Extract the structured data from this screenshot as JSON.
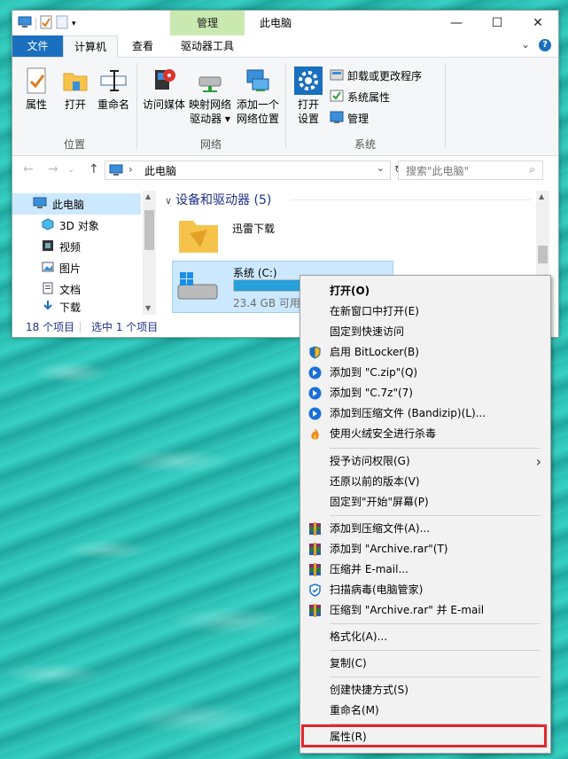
{
  "window": {
    "title": "此电脑",
    "contextual_tab": "管理",
    "controls": [
      "—",
      "☐",
      "✕"
    ]
  },
  "tabs": [
    "文件",
    "计算机",
    "查看",
    "驱动器工具"
  ],
  "ribbon": {
    "groups": [
      {
        "label": "位置",
        "buttons": [
          "属性",
          "打开",
          "重命名"
        ]
      },
      {
        "label": "网络",
        "buttons": [
          "访问媒体",
          "映射网络\n驱动器 ▾",
          "添加一个\n网络位置"
        ]
      },
      {
        "label": "系统",
        "buttons": [
          "打开\n设置"
        ],
        "small": [
          "卸载或更改程序",
          "系统属性",
          "管理"
        ]
      }
    ],
    "location_label": "位置",
    "network_label": "网络",
    "system_label": "系统",
    "btn_properties": "属性",
    "btn_open": "打开",
    "btn_rename": "重命名",
    "btn_media": "访问媒体",
    "btn_map_line1": "映射网络",
    "btn_map_line2": "驱动器 ▾",
    "btn_addnet_line1": "添加一个",
    "btn_addnet_line2": "网络位置",
    "btn_settings_line1": "打开",
    "btn_settings_line2": "设置",
    "small_uninstall": "卸载或更改程序",
    "small_sysprops": "系统属性",
    "small_manage": "管理"
  },
  "address": {
    "path": "此电脑",
    "search_placeholder": "搜索\"此电脑\""
  },
  "navpane": {
    "items": [
      "此电脑",
      "3D 对象",
      "视频",
      "图片",
      "文档",
      "下载"
    ]
  },
  "content": {
    "group_title": "设备和驱动器 (5)",
    "items": [
      {
        "name": "迅雷下载"
      },
      {
        "name": "系统 (C:)",
        "free": "23.4 GB 可用，",
        "usage_fraction": 0.55
      }
    ]
  },
  "status": {
    "count": "18 个项目",
    "selected": "选中 1 个项目"
  },
  "context_menu": {
    "items": [
      "打开(O)",
      "在新窗口中打开(E)",
      "固定到快速访问",
      "启用 BitLocker(B)",
      "添加到 \"C.zip\"(Q)",
      "添加到 \"C.7z\"(7)",
      "添加到压缩文件 (Bandizip)(L)...",
      "使用火绒安全进行杀毒",
      "授予访问权限(G)",
      "还原以前的版本(V)",
      "固定到\"开始\"屏幕(P)",
      "添加到压缩文件(A)...",
      "添加到 \"Archive.rar\"(T)",
      "压缩并 E-mail...",
      "扫描病毒(电脑管家)",
      "压缩到 \"Archive.rar\" 并 E-mail",
      "格式化(A)...",
      "复制(C)",
      "创建快捷方式(S)",
      "重命名(M)",
      "属性(R)"
    ],
    "submenu_arrow": "›"
  },
  "colors": {
    "accent": "#1a6fbf",
    "manage_tab": "#c9e9b0",
    "selection": "#cce8ff",
    "highlight_border": "#e0282e"
  }
}
